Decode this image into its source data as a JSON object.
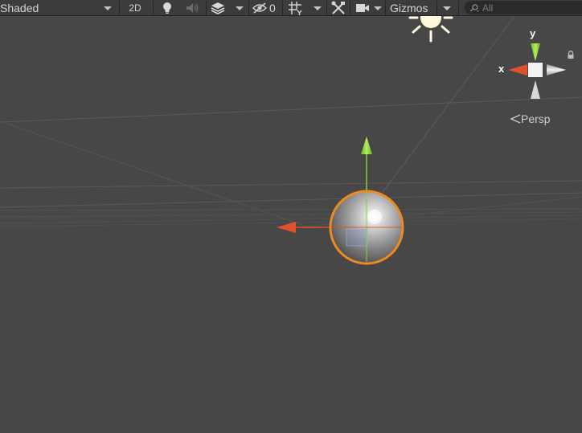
{
  "toolbar": {
    "shading_mode": "Shaded",
    "mode_2d_label": "2D",
    "hidden_count": "0",
    "gizmos_label": "Gizmos",
    "search": {
      "placeholder": "All"
    }
  },
  "icons": {
    "shading_dropdown": "chevron-down-icon",
    "lighting": "lightbulb-icon",
    "audio": "speaker-icon",
    "effects": "layers-icon",
    "hidden_objects": "eye-slash-icon",
    "grid": "grid-icon",
    "tools": "tools-icon",
    "camera": "camera-icon",
    "search": "search-icon",
    "scene_light": "sun-icon",
    "lock": "lock-icon"
  },
  "scene_gizmo": {
    "projection_label": "Persp",
    "y_axis_label": "y",
    "x_axis_label": "x"
  },
  "colors": {
    "background": "#474747",
    "toolbar": "#3c3c3c",
    "x_axis": "#e0502b",
    "y_axis": "#8ccf3a",
    "selection_outline": "#f08a1e"
  }
}
